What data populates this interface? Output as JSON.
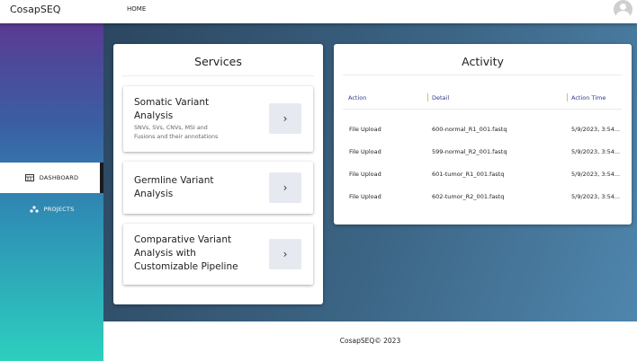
{
  "header": {
    "brand": "CosapSEQ",
    "nav_home": "HOME",
    "avatar_icon": "user-avatar-icon"
  },
  "sidebar": {
    "items": [
      {
        "label": "DASHBOARD",
        "icon": "dashboard-icon",
        "active": true
      },
      {
        "label": "PROJECTS",
        "icon": "projects-icon",
        "active": false
      }
    ],
    "gradient": [
      "#5a3a93",
      "#3a5fa3",
      "#2d94b6",
      "#2dcfbf"
    ]
  },
  "services": {
    "title": "Services",
    "items": [
      {
        "title_lines": [
          "Somatic Variant",
          "Analysis"
        ],
        "subtitle_lines": [
          "SNVs, SVs, CNVs, MSI and",
          "Fusions and their annotations"
        ],
        "button": "›"
      },
      {
        "title_lines": [
          "Germline Variant",
          "Analysis"
        ],
        "button": "›"
      },
      {
        "title_lines": [
          "Comparative Variant",
          "Analysis with",
          "Customizable Pipeline"
        ],
        "button": "›"
      }
    ]
  },
  "activity": {
    "title": "Activity",
    "columns": [
      "Action",
      "Detail",
      "Action Time"
    ],
    "rows": [
      [
        "File Upload",
        "600-normal_R1_001.fastq",
        "5/9/2023, 3:54..."
      ],
      [
        "File Upload",
        "599-normal_R2_001.fastq",
        "5/9/2023, 3:54..."
      ],
      [
        "File Upload",
        "601-tumor_R1_001.fastq",
        "5/9/2023, 3:54..."
      ],
      [
        "File Upload",
        "602-tumor_R2_001.fastq",
        "5/9/2023, 3:54..."
      ]
    ],
    "header_color": "#2d3a8c",
    "separator_color": "#e6b85c"
  },
  "footer": {
    "text": "CosapSEQ© 2023"
  }
}
